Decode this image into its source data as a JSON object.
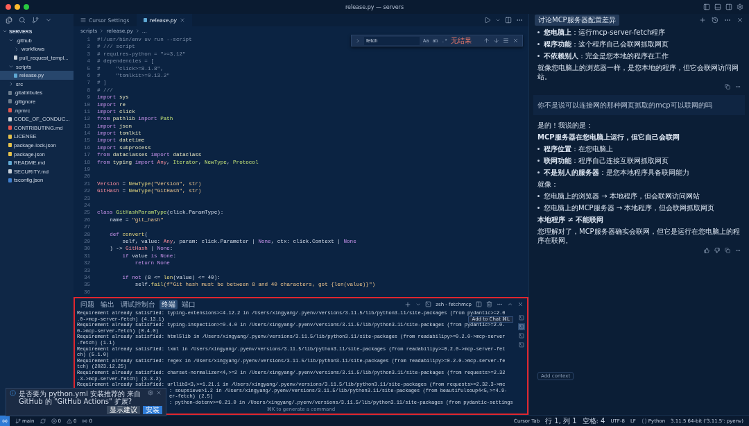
{
  "window": {
    "title": "release.py — servers"
  },
  "sidebar": {
    "title": "SERVERS",
    "expanded": true,
    "items": [
      {
        "label": ".github",
        "kind": "folder",
        "expanded": true,
        "selected": false,
        "children": [
          {
            "label": "workflows",
            "kind": "folder",
            "expanded": false,
            "selected": false
          },
          {
            "label": "pull_request_templ...",
            "kind": "file",
            "selected": false,
            "color": "#c9d1d9"
          }
        ]
      },
      {
        "label": "scripts",
        "kind": "folder",
        "expanded": true,
        "selected": false,
        "children": [
          {
            "label": "release.py",
            "kind": "file",
            "selected": true,
            "color": "#5fa8d3"
          }
        ]
      },
      {
        "label": "src",
        "kind": "folder",
        "expanded": false,
        "selected": false
      },
      {
        "label": ".gitattributes",
        "kind": "file",
        "selected": false,
        "color": "#6b7b8c"
      },
      {
        "label": ".gitignore",
        "kind": "file",
        "selected": false,
        "color": "#6b7b8c"
      },
      {
        "label": ".npmrc",
        "kind": "file",
        "selected": false,
        "color": "#e0574f"
      },
      {
        "label": "CODE_OF_CONDUC...",
        "kind": "file",
        "selected": false,
        "color": "#c9d1d9"
      },
      {
        "label": "CONTRIBUTING.md",
        "kind": "file",
        "selected": false,
        "color": "#e8554e"
      },
      {
        "label": "LICENSE",
        "kind": "file",
        "selected": false,
        "color": "#e3c04b"
      },
      {
        "label": "package-lock.json",
        "kind": "file",
        "selected": false,
        "color": "#e3c04b"
      },
      {
        "label": "package.json",
        "kind": "file",
        "selected": false,
        "color": "#e3c04b"
      },
      {
        "label": "README.md",
        "kind": "file",
        "selected": false,
        "color": "#5fa8d3"
      },
      {
        "label": "SECURITY.md",
        "kind": "file",
        "selected": false,
        "color": "#c9d1d9"
      },
      {
        "label": "tsconfig.json",
        "kind": "file",
        "selected": false,
        "color": "#3f7fcf"
      }
    ]
  },
  "editor": {
    "tabs": [
      {
        "label": "Cursor Settings",
        "selected": false
      },
      {
        "label": "release.py",
        "selected": true
      }
    ],
    "breadcrumb": [
      "scripts",
      "release.py",
      "..."
    ],
    "find": {
      "value": "fetch",
      "options": [
        "Aa",
        "ab",
        ".*"
      ],
      "result": "无结果"
    },
    "lines": [
      {
        "number": "1",
        "segments": [
          {
            "kind": "comment",
            "text": "#!/usr/bin/env uv run --script"
          }
        ]
      },
      {
        "number": "2",
        "segments": [
          {
            "kind": "comment",
            "text": "# /// script"
          }
        ]
      },
      {
        "number": "3",
        "segments": [
          {
            "kind": "comment",
            "text": "# requires-python = \">=3.12\""
          }
        ]
      },
      {
        "number": "4",
        "segments": [
          {
            "kind": "comment",
            "text": "# dependencies = ["
          }
        ]
      },
      {
        "number": "5",
        "segments": [
          {
            "kind": "comment",
            "text": "#     \"click>=8.1.8\","
          }
        ]
      },
      {
        "number": "6",
        "segments": [
          {
            "kind": "comment",
            "text": "#     \"tomlkit>=0.13.2\""
          }
        ]
      },
      {
        "number": "7",
        "segments": [
          {
            "kind": "comment",
            "text": "# ]"
          }
        ]
      },
      {
        "number": "8",
        "segments": [
          {
            "kind": "comment",
            "text": "# ///"
          }
        ]
      },
      {
        "number": "9",
        "segments": [
          {
            "kind": "keyword",
            "text": "import"
          },
          {
            "kind": "module",
            "text": " sys"
          }
        ]
      },
      {
        "number": "10",
        "segments": [
          {
            "kind": "keyword",
            "text": "import"
          },
          {
            "kind": "module",
            "text": " re"
          }
        ]
      },
      {
        "number": "11",
        "segments": [
          {
            "kind": "keyword",
            "text": "import"
          },
          {
            "kind": "module",
            "text": " click"
          }
        ]
      },
      {
        "number": "12",
        "segments": [
          {
            "kind": "keyword",
            "text": "from"
          },
          {
            "kind": "module",
            "text": " pathlib "
          },
          {
            "kind": "keyword",
            "text": "import"
          },
          {
            "kind": "type",
            "text": " Path"
          }
        ]
      },
      {
        "number": "13",
        "segments": [
          {
            "kind": "keyword",
            "text": "import"
          },
          {
            "kind": "module",
            "text": " json"
          }
        ]
      },
      {
        "number": "14",
        "segments": [
          {
            "kind": "keyword",
            "text": "import"
          },
          {
            "kind": "module",
            "text": " tomlkit"
          }
        ]
      },
      {
        "number": "15",
        "segments": [
          {
            "kind": "keyword",
            "text": "import"
          },
          {
            "kind": "module",
            "text": " datetime"
          }
        ]
      },
      {
        "number": "16",
        "segments": [
          {
            "kind": "keyword",
            "text": "import"
          },
          {
            "kind": "module",
            "text": " subprocess"
          }
        ]
      },
      {
        "number": "17",
        "segments": [
          {
            "kind": "keyword",
            "text": "from"
          },
          {
            "kind": "module",
            "text": " dataclasses "
          },
          {
            "kind": "keyword",
            "text": "import"
          },
          {
            "kind": "module",
            "text": " dataclass"
          }
        ]
      },
      {
        "number": "18",
        "segments": [
          {
            "kind": "keyword",
            "text": "from"
          },
          {
            "kind": "module",
            "text": " typing "
          },
          {
            "kind": "keyword",
            "text": "import"
          },
          {
            "kind": "const",
            "text": " Any"
          },
          {
            "kind": "plain",
            "text": ", "
          },
          {
            "kind": "type",
            "text": "Iterator"
          },
          {
            "kind": "plain",
            "text": ", "
          },
          {
            "kind": "type",
            "text": "NewType"
          },
          {
            "kind": "plain",
            "text": ", "
          },
          {
            "kind": "type",
            "text": "Protocol"
          }
        ]
      },
      {
        "number": "19"
      },
      {
        "number": "20"
      },
      {
        "number": "21",
        "segments": [
          {
            "kind": "const",
            "text": "Version"
          },
          {
            "kind": "plain",
            "text": " = "
          },
          {
            "kind": "func",
            "text": "NewType"
          },
          {
            "kind": "string",
            "text": "(\"Version\", str)"
          }
        ]
      },
      {
        "number": "22",
        "segments": [
          {
            "kind": "const",
            "text": "GitHash"
          },
          {
            "kind": "plain",
            "text": " = "
          },
          {
            "kind": "func",
            "text": "NewType"
          },
          {
            "kind": "string",
            "text": "(\"GitHash\", str)"
          }
        ]
      },
      {
        "number": "23"
      },
      {
        "number": "24"
      },
      {
        "number": "25",
        "segments": [
          {
            "kind": "keyword",
            "text": "class"
          },
          {
            "kind": "type",
            "text": " GitHashParamType"
          },
          {
            "kind": "plain",
            "text": "(click.ParamType):"
          }
        ]
      },
      {
        "number": "26",
        "segments": [
          {
            "kind": "plain",
            "text": "    name = "
          },
          {
            "kind": "string",
            "text": "\"git_hash\""
          }
        ]
      },
      {
        "number": "27"
      },
      {
        "number": "28",
        "segments": [
          {
            "kind": "keyword",
            "text": "    def"
          },
          {
            "kind": "func",
            "text": " convert"
          },
          {
            "kind": "plain",
            "text": "("
          }
        ]
      },
      {
        "number": "29",
        "segments": [
          {
            "kind": "plain",
            "text": "        self, value: "
          },
          {
            "kind": "const",
            "text": "Any"
          },
          {
            "kind": "plain",
            "text": ", param: click.Parameter | "
          },
          {
            "kind": "keyword",
            "text": "None"
          },
          {
            "kind": "plain",
            "text": ", ctx: click.Context | "
          },
          {
            "kind": "keyword",
            "text": "None"
          }
        ]
      },
      {
        "number": "30",
        "segments": [
          {
            "kind": "plain",
            "text": "    ) -> "
          },
          {
            "kind": "const",
            "text": "GitHash"
          },
          {
            "kind": "plain",
            "text": " | "
          },
          {
            "kind": "keyword",
            "text": "None"
          },
          {
            "kind": "plain",
            "text": ":"
          }
        ]
      },
      {
        "number": "31",
        "segments": [
          {
            "kind": "keyword",
            "text": "        if"
          },
          {
            "kind": "plain",
            "text": " value "
          },
          {
            "kind": "keyword",
            "text": "is None"
          },
          {
            "kind": "plain",
            "text": ":"
          }
        ]
      },
      {
        "number": "32",
        "segments": [
          {
            "kind": "keyword",
            "text": "            return None"
          }
        ]
      },
      {
        "number": "33"
      },
      {
        "number": "34",
        "segments": [
          {
            "kind": "keyword",
            "text": "        if not"
          },
          {
            "kind": "plain",
            "text": " (8 <= "
          },
          {
            "kind": "func",
            "text": "len"
          },
          {
            "kind": "plain",
            "text": "(value) <= 40):"
          }
        ]
      },
      {
        "number": "35",
        "segments": [
          {
            "kind": "plain",
            "text": "            self."
          },
          {
            "kind": "func",
            "text": "fail"
          },
          {
            "kind": "string",
            "text": "(f\"Git hash must be between 8 and 40 characters, got {len(value)}\")"
          }
        ]
      },
      {
        "number": "36"
      }
    ]
  },
  "terminal": {
    "highlighted": true,
    "tabs": [
      {
        "label": "问题",
        "selected": false
      },
      {
        "label": "输出",
        "selected": false
      },
      {
        "label": "调试控制台",
        "selected": false
      },
      {
        "label": "终端",
        "selected": true
      },
      {
        "label": "端口",
        "selected": false
      }
    ],
    "shell": "zsh - fetchmcp",
    "tooltip": "Add to Chat ⌘L",
    "sessions": [
      {
        "selected": false
      },
      {
        "selected": true
      },
      {
        "selected": false
      },
      {
        "selected": false
      }
    ],
    "lines": [
      {
        "text": "Requirement already satisfied: typing-extensions>=4.12.2 in /Users/xingyang/.pyenv/versions/3.11.5/lib/python3.11/site-packages (from pydantic>=2.0"
      },
      {
        "text": ".0->mcp-server-fetch) (4.13.1)"
      },
      {
        "text": "Requirement already satisfied: typing-inspection>=0.4.0 in /Users/xingyang/.pyenv/versions/3.11.5/lib/python3.11/site-packages (from pydantic>=2.0."
      },
      {
        "text": "0->mcp-server-fetch) (0.4.0)"
      },
      {
        "text": "Requirement already satisfied: html5lib in /Users/xingyang/.pyenv/versions/3.11.5/lib/python3.11/site-packages (from readabilipy>=0.2.0->mcp-server"
      },
      {
        "text": "-fetch) (1.1)"
      },
      {
        "text": "Requirement already satisfied: lxml in /Users/xingyang/.pyenv/versions/3.11.5/lib/python3.11/site-packages (from readabilipy>=0.2.0->mcp-server-fet"
      },
      {
        "text": "ch) (5.1.0)"
      },
      {
        "text": "Requirement already satisfied: regex in /Users/xingyang/.pyenv/versions/3.11.5/lib/python3.11/site-packages (from readabilipy>=0.2.0->mcp-server-fe"
      },
      {
        "text": "tch) (2023.12.25)"
      },
      {
        "text": "Requirement already satisfied: charset-normalizer<4,>=2 in /Users/xingyang/.pyenv/versions/3.11.5/lib/python3.11/site-packages (from requests>=2.32"
      },
      {
        "text": ".3->mcp-server-fetch) (3.3.2)"
      },
      {
        "text": "Requirement already satisfied: urllib3<3,>=1.21.1 in /Users/xingyang/.pyenv/versions/3.11.5/lib/python3.11/site-packages (from requests>=2.32.3->mc"
      },
      {
        "text": ": soupsieve>1.2 in /Users/xingyang/.pyenv/versions/3.11.5/lib/python3.11/site-packages (from beautifulsoup4<5,>=4.9-",
        "covered": true
      },
      {
        "text": "er-fetch) (2.5)",
        "covered": true
      },
      {
        "text": ": python-dotenv>=0.21.0 in /Users/xingyang/.pyenv/versions/3.11.5/lib/python3.11/site-packages (from pydantic-settings",
        "covered": true
      }
    ],
    "hint": "⌘K to generate a command"
  },
  "notification": {
    "message": "是否要为 python.yml 安装推荐的 来自 GitHub 的 \"GitHub Actions\" 扩展?",
    "buttons": [
      {
        "label": "显示建议",
        "kind": "secondary"
      },
      {
        "label": "安装",
        "kind": "primary"
      }
    ]
  },
  "chat": {
    "title": "讨论MCP服务器配置差异",
    "messages": [
      {
        "kind": "assistant",
        "feedback": false,
        "blocks": [
          {
            "kind": "bullet",
            "text": "**您电脑上**：运行mcp-server-fetch程序"
          },
          {
            "kind": "bullet",
            "text": "**程序功能**：这个程序自己会联网抓取网页"
          },
          {
            "kind": "bullet",
            "text": "**不依赖别人**：完全是您本地的程序在工作"
          },
          {
            "kind": "para",
            "text": "就像您电脑上的浏览器一样，是您本地的程序，但它会联网访问网站。"
          }
        ]
      },
      {
        "kind": "user",
        "blocks": [
          {
            "kind": "para",
            "text": "你不是说可以连接网的那种网页抓取的mcp可以联网的吗"
          }
        ]
      },
      {
        "kind": "assistant",
        "feedback": true,
        "blocks": [
          {
            "kind": "para",
            "text": "是的！我说的是："
          },
          {
            "kind": "strong",
            "text": "MCP服务器在您电脑上运行，但它自己会联网"
          },
          {
            "kind": "bullet",
            "text": "**程序位置**：在您电脑上"
          },
          {
            "kind": "bullet",
            "text": "**联网功能**：程序自己连接互联网抓取网页"
          },
          {
            "kind": "bullet",
            "text": "**不是别人的服务器**：是您本地程序具备联网能力"
          },
          {
            "kind": "para",
            "text": "就像："
          },
          {
            "kind": "bullet",
            "text": "您电脑上的浏览器 → 本地程序，但会联网访问网站"
          },
          {
            "kind": "bullet",
            "text": "您电脑上的MCP服务器 → 本地程序，但会联网抓取网页"
          },
          {
            "kind": "strong",
            "text": "本地程序 ≠ 不能联网"
          },
          {
            "kind": "para",
            "text": "您理解对了，MCP服务器确实会联网，但它是运行在您电脑上的程序在联网。"
          }
        ]
      }
    ],
    "add_context": "Add context"
  },
  "status_bar": {
    "branch": "main",
    "errors": "0",
    "warnings": "0",
    "ports": "0",
    "right": [
      {
        "text": "Cursor Tab",
        "kind": "plain"
      },
      {
        "text": "行 1, 列 1",
        "kind": "plain"
      },
      {
        "text": "空格: 4",
        "kind": "plain"
      },
      {
        "text": "UTF-8",
        "kind": "plain"
      },
      {
        "text": "LF",
        "kind": "plain"
      },
      {
        "text": "Python",
        "kind": "language"
      },
      {
        "text": "3.11.5 64-bit ('3.11.5': pyenv)",
        "kind": "plain"
      }
    ]
  }
}
